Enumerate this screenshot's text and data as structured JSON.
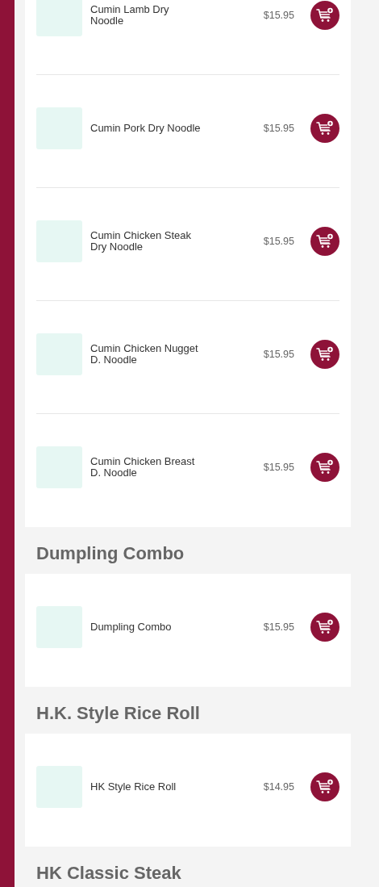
{
  "sections": [
    {
      "items": [
        {
          "name": "Cumin Lamb Dry Noodle",
          "price": "$15.95"
        },
        {
          "name": "Cumin Pork Dry Noodle",
          "price": "$15.95"
        },
        {
          "name": "Cumin Chicken Steak Dry Noodle",
          "price": "$15.95"
        },
        {
          "name": "Cumin Chicken Nugget D. Noodle",
          "price": "$15.95"
        },
        {
          "name": "Cumin Chicken Breast D. Noodle",
          "price": "$15.95"
        }
      ]
    },
    {
      "title": "Dumpling Combo",
      "items": [
        {
          "name": "Dumpling Combo",
          "price": "$15.95"
        }
      ]
    },
    {
      "title": "H.K. Style Rice Roll",
      "items": [
        {
          "name": "HK Style Rice Roll",
          "price": "$14.95"
        }
      ]
    },
    {
      "title": "HK Classic Steak"
    }
  ]
}
